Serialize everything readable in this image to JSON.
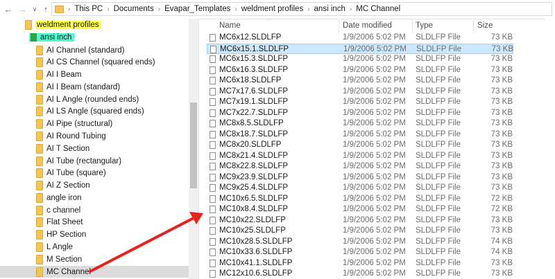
{
  "address": {
    "crumbs": [
      "This PC",
      "Documents",
      "Evapar_Templates",
      "weldment profiles",
      "ansi inch",
      "MC Channel"
    ]
  },
  "nav": {
    "highlighted": [
      {
        "label": "weldment profiles",
        "highlight": "#ffff47"
      },
      {
        "label": "ansi inch",
        "highlight": "#52f7ce"
      }
    ],
    "folders": [
      "AI Channel (standard)",
      "AI CS Channel (squared ends)",
      "AI I Beam",
      "AI I Beam (standard)",
      "AI L Angle (rounded ends)",
      "AI LS Angle (squared ends)",
      "AI Pipe (structural)",
      "AI Round Tubing",
      "AI T Section",
      "AI Tube (rectangular)",
      "AI Tube (square)",
      "AI Z Section",
      "angle iron",
      "c channel",
      "Flat Sheet",
      "HP Section",
      "L Angle",
      "M Section",
      "MC Channel"
    ],
    "selected_folder": "MC Channel"
  },
  "list": {
    "columns": [
      "Name",
      "Date modified",
      "Type",
      "Size"
    ],
    "selected_file": "MC6x15.1.SLDLFP",
    "files": [
      {
        "name": "MC6x12.SLDLFP",
        "date": "1/9/2006 5:02 PM",
        "type": "SLDLFP File",
        "size": "73 KB"
      },
      {
        "name": "MC6x15.1.SLDLFP",
        "date": "1/9/2006 5:02 PM",
        "type": "SLDLFP File",
        "size": "73 KB"
      },
      {
        "name": "MC6x15.3.SLDLFP",
        "date": "1/9/2006 5:02 PM",
        "type": "SLDLFP File",
        "size": "73 KB"
      },
      {
        "name": "MC6x16.3.SLDLFP",
        "date": "1/9/2006 5:02 PM",
        "type": "SLDLFP File",
        "size": "73 KB"
      },
      {
        "name": "MC6x18.SLDLFP",
        "date": "1/9/2006 5:02 PM",
        "type": "SLDLFP File",
        "size": "73 KB"
      },
      {
        "name": "MC7x17.6.SLDLFP",
        "date": "1/9/2006 5:02 PM",
        "type": "SLDLFP File",
        "size": "73 KB"
      },
      {
        "name": "MC7x19.1.SLDLFP",
        "date": "1/9/2006 5:02 PM",
        "type": "SLDLFP File",
        "size": "73 KB"
      },
      {
        "name": "MC7x22.7.SLDLFP",
        "date": "1/9/2006 5:02 PM",
        "type": "SLDLFP File",
        "size": "73 KB"
      },
      {
        "name": "MC8x8.5.SLDLFP",
        "date": "1/9/2006 5:02 PM",
        "type": "SLDLFP File",
        "size": "73 KB"
      },
      {
        "name": "MC8x18.7.SLDLFP",
        "date": "1/9/2006 5:02 PM",
        "type": "SLDLFP File",
        "size": "73 KB"
      },
      {
        "name": "MC8x20.SLDLFP",
        "date": "1/9/2006 5:02 PM",
        "type": "SLDLFP File",
        "size": "73 KB"
      },
      {
        "name": "MC8x21.4.SLDLFP",
        "date": "1/9/2006 5:02 PM",
        "type": "SLDLFP File",
        "size": "73 KB"
      },
      {
        "name": "MC8x22.8.SLDLFP",
        "date": "1/9/2006 5:02 PM",
        "type": "SLDLFP File",
        "size": "73 KB"
      },
      {
        "name": "MC9x23.9.SLDLFP",
        "date": "1/9/2006 5:02 PM",
        "type": "SLDLFP File",
        "size": "73 KB"
      },
      {
        "name": "MC9x25.4.SLDLFP",
        "date": "1/9/2006 5:02 PM",
        "type": "SLDLFP File",
        "size": "73 KB"
      },
      {
        "name": "MC10x6.5.SLDLFP",
        "date": "1/9/2006 5:02 PM",
        "type": "SLDLFP File",
        "size": "72 KB"
      },
      {
        "name": "MC10x8.4.SLDLFP",
        "date": "1/9/2006 5:02 PM",
        "type": "SLDLFP File",
        "size": "72 KB"
      },
      {
        "name": "MC10x22.SLDLFP",
        "date": "1/9/2006 5:02 PM",
        "type": "SLDLFP File",
        "size": "73 KB"
      },
      {
        "name": "MC10x25.SLDLFP",
        "date": "1/9/2006 5:02 PM",
        "type": "SLDLFP File",
        "size": "73 KB"
      },
      {
        "name": "MC10x28.5.SLDLFP",
        "date": "1/9/2006 5:02 PM",
        "type": "SLDLFP File",
        "size": "74 KB"
      },
      {
        "name": "MC10x33.6.SLDLFP",
        "date": "1/9/2006 5:02 PM",
        "type": "SLDLFP File",
        "size": "74 KB"
      },
      {
        "name": "MC10x41.1.SLDLFP",
        "date": "1/9/2006 5:02 PM",
        "type": "SLDLFP File",
        "size": "73 KB"
      },
      {
        "name": "MC12x10.6.SLDLFP",
        "date": "1/9/2006 5:02 PM",
        "type": "SLDLFP File",
        "size": "73 KB"
      }
    ]
  },
  "annotation": {
    "arrow_color": "#e8211c"
  }
}
